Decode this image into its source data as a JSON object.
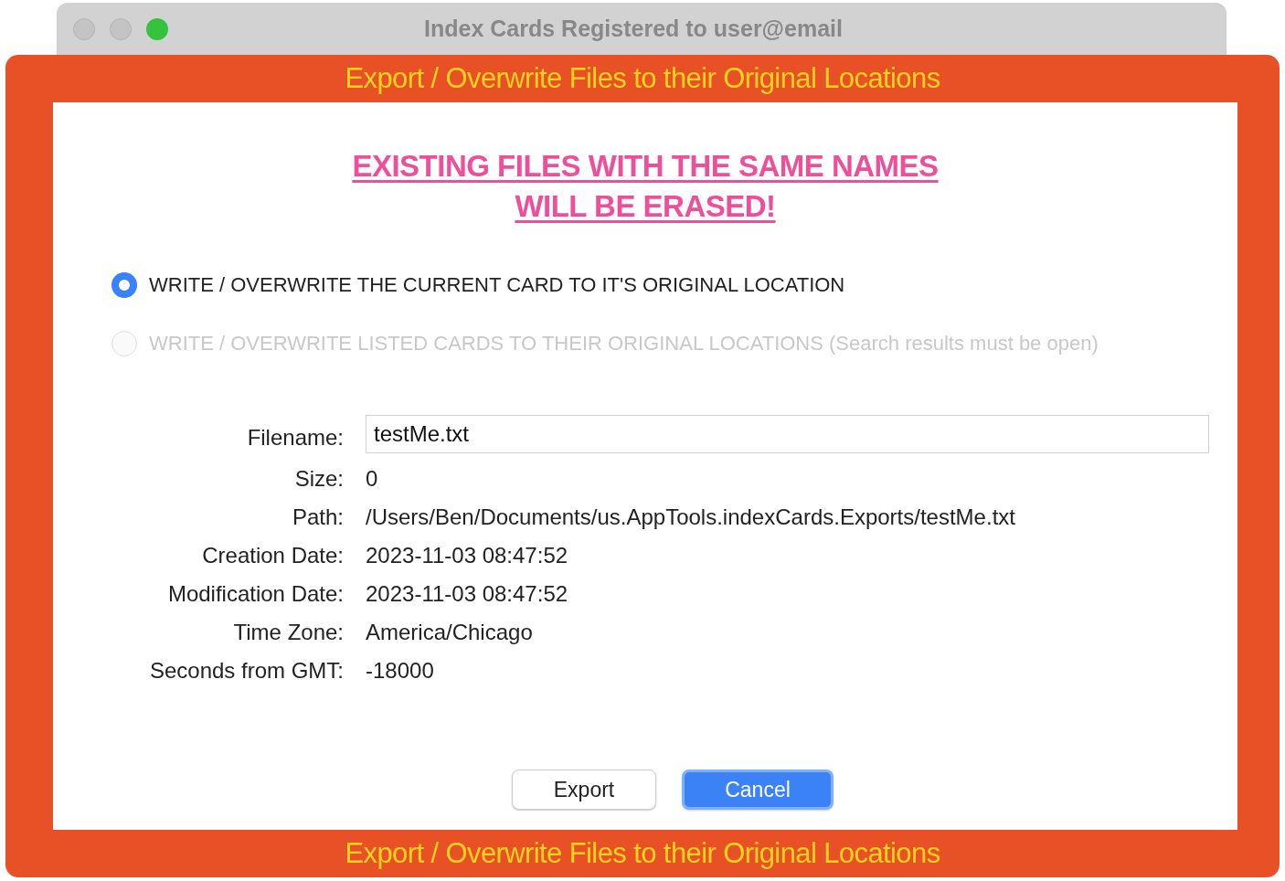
{
  "window": {
    "title": "Index Cards Registered to user@email"
  },
  "sheet": {
    "header_title": "Export / Overwrite Files to their Original Locations",
    "warning": [
      "EXISTING FILES WITH THE SAME NAMES",
      "WILL BE ERASED!"
    ],
    "options": [
      {
        "label": "WRITE / OVERWRITE THE CURRENT CARD TO IT'S ORIGINAL LOCATION",
        "selected": true,
        "disabled": false
      },
      {
        "label": "WRITE / OVERWRITE LISTED CARDS TO THEIR ORIGINAL LOCATIONS (Search results must be open)",
        "selected": false,
        "disabled": true
      }
    ],
    "fields": [
      {
        "kind": "input",
        "label": "Filename:",
        "value": "testMe.txt"
      },
      {
        "kind": "text",
        "label": "Size:",
        "value": "0"
      },
      {
        "kind": "text",
        "label": "Path:",
        "value": "/Users/Ben/Documents/us.AppTools.indexCards.Exports/testMe.txt"
      },
      {
        "kind": "text",
        "label": "Creation Date:",
        "value": "2023-11-03 08:47:52"
      },
      {
        "kind": "text",
        "label": "Modification Date:",
        "value": "2023-11-03 08:47:52"
      },
      {
        "kind": "text",
        "label": "Time Zone:",
        "value": "America/Chicago"
      },
      {
        "kind": "text",
        "label": "Seconds from GMT:",
        "value": "-18000"
      }
    ],
    "buttons": [
      {
        "label": "Export",
        "default": false
      },
      {
        "label": "Cancel",
        "default": true
      }
    ],
    "footer_title": "Export / Overwrite Files to their Original Locations"
  }
}
